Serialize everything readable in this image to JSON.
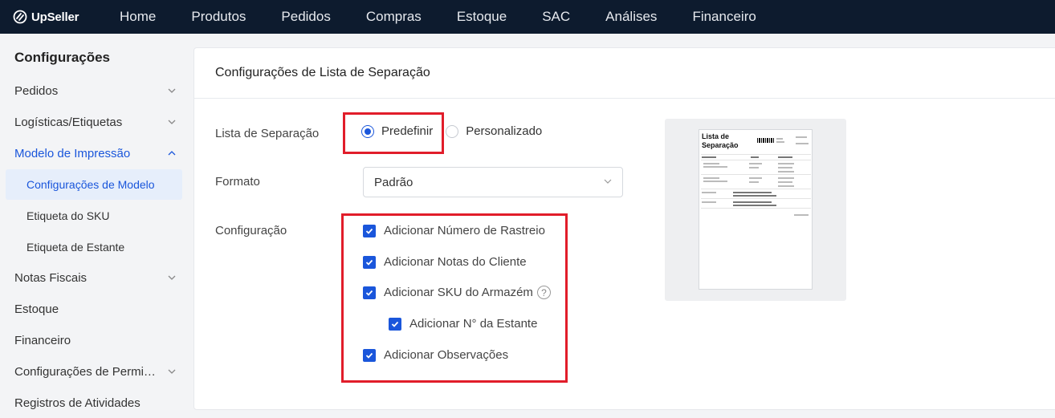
{
  "app": {
    "logo_text": "UpSeller",
    "accent_color": "#1a56db",
    "highlight_color": "#e11d2a"
  },
  "nav": {
    "items": [
      "Home",
      "Produtos",
      "Pedidos",
      "Compras",
      "Estoque",
      "SAC",
      "Análises",
      "Financeiro"
    ]
  },
  "sidebar": {
    "title": "Configurações",
    "items": [
      {
        "label": "Pedidos",
        "chevron": "down"
      },
      {
        "label": "Logísticas/Etiquetas",
        "chevron": "down"
      },
      {
        "label": "Modelo de Impressão",
        "chevron": "up"
      },
      {
        "label": "Notas Fiscais",
        "chevron": "down"
      },
      {
        "label": "Estoque",
        "chevron": ""
      },
      {
        "label": "Financeiro",
        "chevron": ""
      },
      {
        "label": "Configurações de Permissão",
        "chevron": "down"
      },
      {
        "label": "Registros de Atividades",
        "chevron": ""
      }
    ],
    "subitems": [
      {
        "label": "Configurações de Modelo",
        "selected": true
      },
      {
        "label": "Etiqueta do SKU",
        "selected": false
      },
      {
        "label": "Etiqueta de Estante",
        "selected": false
      }
    ]
  },
  "main": {
    "title": "Configurações de Lista de Separação",
    "lista_label": "Lista de Separação",
    "radio": {
      "options": [
        "Predefinir",
        "Personalizado"
      ],
      "selected": "Predefinir"
    },
    "formato_label": "Formato",
    "formato_value": "Padrão",
    "config_label": "Configuração",
    "checkboxes": [
      {
        "label": "Adicionar Número de Rastreio",
        "checked": true
      },
      {
        "label": "Adicionar Notas do Cliente",
        "checked": true
      },
      {
        "label": "Adicionar SKU do Armazém",
        "checked": true,
        "help": "?"
      },
      {
        "label": "Adicionar N° da Estante",
        "checked": true
      },
      {
        "label": "Adicionar Observações",
        "checked": true
      }
    ]
  },
  "preview": {
    "paper_title": "Lista de Separação"
  }
}
